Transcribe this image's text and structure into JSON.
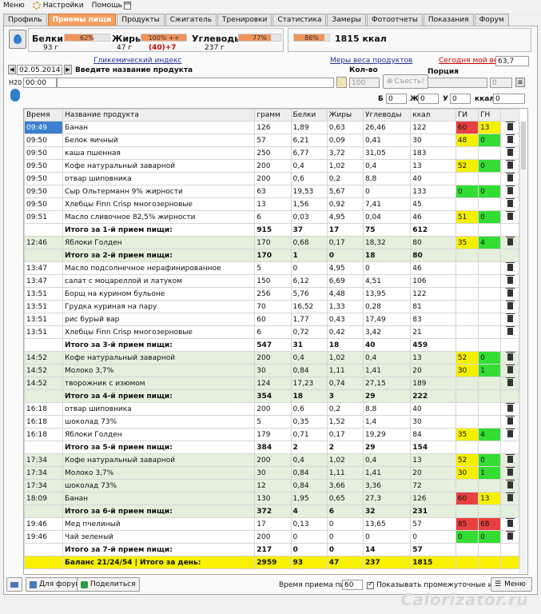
{
  "menu": {
    "file": "Меню",
    "settings": "Настройки",
    "help": "Помощь"
  },
  "tabs": [
    "Профиль",
    "Приемы пищи",
    "Продукты",
    "Сжигатель",
    "Тренировки",
    "Статистика",
    "Замеры",
    "Фотоотчеты",
    "Показания",
    "Форум"
  ],
  "active_tab": "Приемы пищи",
  "macros": {
    "protein": {
      "label": "Белки",
      "percent": "62%",
      "fill": 62,
      "amount": "93 г"
    },
    "fat": {
      "label": "Жиры",
      "percent": "100% ++",
      "fill": 100,
      "amount": "47 г",
      "over": "(40)+7"
    },
    "carbs": {
      "label": "Углеводы",
      "percent": "77%",
      "fill": 77,
      "amount": "237 г"
    }
  },
  "kcal": {
    "percent": "86%",
    "fill": 86,
    "total": "1815 ккал"
  },
  "glycemic_link": "Гликемический индекс",
  "measures_link": "Меры веса продуктов",
  "weight_label": "Сегодня мой вес:",
  "weight_value": "63,7",
  "date": "02.05.2014",
  "time": "00:00",
  "product_placeholder": "Введите название продукта",
  "qty_label": "Кол-во",
  "qty_value": "100",
  "eat_button": "Съесть!",
  "portion_label": "Порция",
  "portion_value": "0",
  "mini": {
    "b_label": "Б",
    "b": "0",
    "zh_label": "Ж",
    "zh": "0",
    "u_label": "У",
    "u": "0",
    "kcal_label": "ккал",
    "kcal": "0"
  },
  "h2o": "H20",
  "columns": [
    "Время",
    "Название продукта",
    "грамм",
    "Белки",
    "Жиры",
    "Углеводы",
    "ккал",
    "ГИ",
    "ГН",
    ""
  ],
  "rows": [
    {
      "t": "r",
      "time": "09:49",
      "name": "Банан",
      "g": "126",
      "b": "1,89",
      "f": "0,63",
      "c": "26,46",
      "k": "122",
      "gi": "60",
      "gn": "13",
      "gic": "hi",
      "gnc": "ye",
      "del": true,
      "sel": true
    },
    {
      "t": "r",
      "time": "09:50",
      "name": "Белок яичный",
      "g": "57",
      "b": "6,21",
      "f": "0,09",
      "c": "0,41",
      "k": "30",
      "gi": "48",
      "gn": "0",
      "gic": "ye",
      "gnc": "gr",
      "del": true
    },
    {
      "t": "r",
      "time": "09:50",
      "name": "каша пшенная",
      "g": "250",
      "b": "6,77",
      "f": "3,72",
      "c": "31,05",
      "k": "183",
      "gi": "",
      "gn": "",
      "del": true
    },
    {
      "t": "r",
      "time": "09:50",
      "name": "Кофе натуральный заварной",
      "g": "200",
      "b": "0,4",
      "f": "1,02",
      "c": "0,4",
      "k": "13",
      "gi": "52",
      "gn": "0",
      "gic": "ye",
      "gnc": "gr",
      "del": true
    },
    {
      "t": "r",
      "time": "09:50",
      "name": "отвар шиповника",
      "g": "200",
      "b": "0,6",
      "f": "0,2",
      "c": "8,8",
      "k": "40",
      "gi": "",
      "gn": "",
      "del": true
    },
    {
      "t": "r",
      "time": "09:50",
      "name": "Сыр Ольтерманн 9% жирности",
      "g": "63",
      "b": "19,53",
      "f": "5,67",
      "c": "0",
      "k": "133",
      "gi": "0",
      "gn": "0",
      "gic": "gr",
      "gnc": "gr",
      "del": true
    },
    {
      "t": "r",
      "time": "09:50",
      "name": "Хлебцы Finn Crisp многозерновые",
      "g": "13",
      "b": "1,56",
      "f": "0,92",
      "c": "7,41",
      "k": "45",
      "gi": "",
      "gn": "",
      "del": true
    },
    {
      "t": "r",
      "time": "09:51",
      "name": "Масло сливочное 82,5% жирности",
      "g": "6",
      "b": "0,03",
      "f": "4,95",
      "c": "0,04",
      "k": "46",
      "gi": "51",
      "gn": "0",
      "gic": "ye",
      "gnc": "gr",
      "del": true
    },
    {
      "t": "s",
      "name": "Итого за 1-й прием пищи:",
      "g": "915",
      "b": "37",
      "f": "17",
      "c": "75",
      "k": "612"
    },
    {
      "t": "r",
      "grp": true,
      "time": "12:46",
      "name": "Яблоки Голден",
      "g": "170",
      "b": "0,68",
      "f": "0,17",
      "c": "18,32",
      "k": "80",
      "gi": "35",
      "gn": "4",
      "gic": "ye",
      "gnc": "gr",
      "del": true
    },
    {
      "t": "s",
      "grp": true,
      "name": "Итого за 2-й прием пищи:",
      "g": "170",
      "b": "1",
      "f": "0",
      "c": "18",
      "k": "80"
    },
    {
      "t": "r",
      "time": "13:47",
      "name": "Масло подсолнечное нерафинированное",
      "g": "5",
      "b": "0",
      "f": "4,95",
      "c": "0",
      "k": "46",
      "gi": "",
      "gn": "",
      "del": true
    },
    {
      "t": "r",
      "time": "13:47",
      "name": "салат с моцареллой и латуком",
      "g": "150",
      "b": "6,12",
      "f": "6,69",
      "c": "4,51",
      "k": "106",
      "gi": "",
      "gn": "",
      "del": true
    },
    {
      "t": "r",
      "time": "13:51",
      "name": "Борщ на курином бульоне",
      "g": "256",
      "b": "5,76",
      "f": "4,48",
      "c": "13,95",
      "k": "122",
      "gi": "",
      "gn": "",
      "del": true
    },
    {
      "t": "r",
      "time": "13:51",
      "name": "Грудка куриная на пару",
      "g": "70",
      "b": "16,52",
      "f": "1,33",
      "c": "0,28",
      "k": "81",
      "gi": "",
      "gn": "",
      "del": true
    },
    {
      "t": "r",
      "time": "13:51",
      "name": "рис бурый вар",
      "g": "60",
      "b": "1,77",
      "f": "0,43",
      "c": "17,49",
      "k": "83",
      "gi": "",
      "gn": "",
      "del": true
    },
    {
      "t": "r",
      "time": "13:51",
      "name": "Хлебцы Finn Crisp многозерновые",
      "g": "6",
      "b": "0,72",
      "f": "0,42",
      "c": "3,42",
      "k": "21",
      "gi": "",
      "gn": "",
      "del": true
    },
    {
      "t": "s",
      "name": "Итого за 3-й прием пищи:",
      "g": "547",
      "b": "31",
      "f": "18",
      "c": "40",
      "k": "459"
    },
    {
      "t": "r",
      "grp": true,
      "time": "14:52",
      "name": "Кофе натуральный заварной",
      "g": "200",
      "b": "0,4",
      "f": "1,02",
      "c": "0,4",
      "k": "13",
      "gi": "52",
      "gn": "0",
      "gic": "ye",
      "gnc": "gr",
      "del": true
    },
    {
      "t": "r",
      "grp": true,
      "time": "14:52",
      "name": "Молоко 3,7%",
      "g": "30",
      "b": "0,84",
      "f": "1,11",
      "c": "1,41",
      "k": "20",
      "gi": "30",
      "gn": "1",
      "gic": "ye",
      "gnc": "gr",
      "del": true
    },
    {
      "t": "r",
      "grp": true,
      "time": "14:52",
      "name": "творожник с изюмом",
      "g": "124",
      "b": "17,23",
      "f": "0,74",
      "c": "27,15",
      "k": "189",
      "gi": "",
      "gn": "",
      "del": true
    },
    {
      "t": "s",
      "grp": true,
      "name": "Итого за 4-й прием пищи:",
      "g": "354",
      "b": "18",
      "f": "3",
      "c": "29",
      "k": "222"
    },
    {
      "t": "r",
      "time": "16:18",
      "name": "отвар шиповника",
      "g": "200",
      "b": "0,6",
      "f": "0,2",
      "c": "8,8",
      "k": "40",
      "gi": "",
      "gn": "",
      "del": true
    },
    {
      "t": "r",
      "time": "16:18",
      "name": "шоколад 73%",
      "g": "5",
      "b": "0,35",
      "f": "1,52",
      "c": "1,4",
      "k": "30",
      "gi": "",
      "gn": "",
      "del": true
    },
    {
      "t": "r",
      "time": "16:18",
      "name": "Яблоки Голден",
      "g": "179",
      "b": "0,71",
      "f": "0,17",
      "c": "19,29",
      "k": "84",
      "gi": "35",
      "gn": "4",
      "gic": "ye",
      "gnc": "gr",
      "del": true
    },
    {
      "t": "s",
      "name": "Итого за 5-й прием пищи:",
      "g": "384",
      "b": "2",
      "f": "2",
      "c": "29",
      "k": "154"
    },
    {
      "t": "r",
      "grp": true,
      "time": "17:34",
      "name": "Кофе натуральный заварной",
      "g": "200",
      "b": "0,4",
      "f": "1,02",
      "c": "0,4",
      "k": "13",
      "gi": "52",
      "gn": "0",
      "gic": "ye",
      "gnc": "gr",
      "del": true
    },
    {
      "t": "r",
      "grp": true,
      "time": "17:34",
      "name": "Молоко 3,7%",
      "g": "30",
      "b": "0,84",
      "f": "1,11",
      "c": "1,41",
      "k": "20",
      "gi": "30",
      "gn": "1",
      "gic": "ye",
      "gnc": "gr",
      "del": true
    },
    {
      "t": "r",
      "grp": true,
      "time": "17:34",
      "name": "шоколад 73%",
      "g": "12",
      "b": "0,84",
      "f": "3,66",
      "c": "3,36",
      "k": "72",
      "gi": "",
      "gn": "",
      "del": true
    },
    {
      "t": "r",
      "grp": true,
      "time": "18:09",
      "name": "Банан",
      "g": "130",
      "b": "1,95",
      "f": "0,65",
      "c": "27,3",
      "k": "126",
      "gi": "60",
      "gn": "13",
      "gic": "hi",
      "gnc": "ye",
      "del": true
    },
    {
      "t": "s",
      "grp": true,
      "name": "Итого за 6-й прием пищи:",
      "g": "372",
      "b": "4",
      "f": "6",
      "c": "32",
      "k": "231"
    },
    {
      "t": "r",
      "time": "19:46",
      "name": "Мед пчелиный",
      "g": "17",
      "b": "0,13",
      "f": "0",
      "c": "13,65",
      "k": "57",
      "gi": "85",
      "gn": "68",
      "gic": "hi",
      "gnc": "hi",
      "del": true
    },
    {
      "t": "r",
      "time": "19:46",
      "name": "Чай зеленый",
      "g": "200",
      "b": "0",
      "f": "0",
      "c": "0",
      "k": "0",
      "gi": "0",
      "gn": "0",
      "gic": "gr",
      "gnc": "gr",
      "del": true
    },
    {
      "t": "s",
      "name": "Итого за 7-й прием пищи:",
      "g": "217",
      "b": "0",
      "f": "0",
      "c": "14",
      "k": "57"
    },
    {
      "t": "b",
      "name": "Баланс 21/24/54  |  Итого за день:",
      "g": "2959",
      "b": "93",
      "f": "47",
      "c": "237",
      "k": "1815"
    }
  ],
  "bottom": {
    "forum_btn": "Для форума",
    "share_btn": "Поделиться",
    "interval_label": "Время приема пищи",
    "interval_value": "60",
    "show_subtotals": "Показывать промежуточные итоги",
    "menu_btn": "Меню"
  },
  "watermark": "Calorizator.ru"
}
